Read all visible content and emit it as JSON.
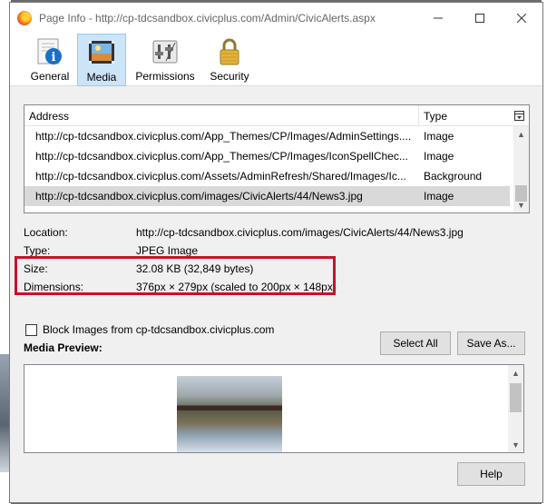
{
  "window": {
    "title": "Page Info - http://cp-tdcsandbox.civicplus.com/Admin/CivicAlerts.aspx"
  },
  "toolbar": {
    "tabs": [
      {
        "label": "General",
        "icon": "info-icon",
        "active": false
      },
      {
        "label": "Media",
        "icon": "media-icon",
        "active": true
      },
      {
        "label": "Permissions",
        "icon": "permissions-icon",
        "active": false
      },
      {
        "label": "Security",
        "icon": "lock-icon",
        "active": false
      }
    ]
  },
  "media_table": {
    "headers": {
      "address": "Address",
      "type": "Type"
    },
    "rows": [
      {
        "address": "http://cp-tdcsandbox.civicplus.com/App_Themes/CP/Images/AdminSettings....",
        "type": "Image",
        "selected": false
      },
      {
        "address": "http://cp-tdcsandbox.civicplus.com/App_Themes/CP/Images/IconSpellChec...",
        "type": "Image",
        "selected": false
      },
      {
        "address": "http://cp-tdcsandbox.civicplus.com/Assets/AdminRefresh/Shared/Images/Ic...",
        "type": "Background",
        "selected": false
      },
      {
        "address": "http://cp-tdcsandbox.civicplus.com/images/CivicAlerts/44/News3.jpg",
        "type": "Image",
        "selected": true
      }
    ]
  },
  "details": {
    "location_label": "Location:",
    "location_value": "http://cp-tdcsandbox.civicplus.com/images/CivicAlerts/44/News3.jpg",
    "type_label": "Type:",
    "type_value": "JPEG Image",
    "size_label": "Size:",
    "size_value": "32.08 KB (32,849 bytes)",
    "dimensions_label": "Dimensions:",
    "dimensions_value": "376px × 279px (scaled to 200px × 148px)"
  },
  "block": {
    "label": "Block Images from cp-tdcsandbox.civicplus.com",
    "checked": false
  },
  "buttons": {
    "select_all": "Select All",
    "save_as": "Save As...",
    "help": "Help"
  },
  "preview": {
    "label": "Media Preview:"
  },
  "colors": {
    "highlight": "#c4132b",
    "active_tab_bg": "#cce4f7"
  }
}
